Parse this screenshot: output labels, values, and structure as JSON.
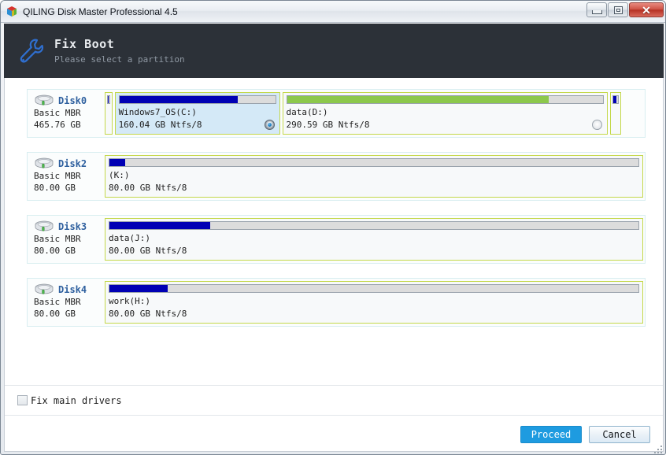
{
  "window": {
    "title": "QILING Disk Master Professional 4.5",
    "logo_icon": "cube-logo-icon",
    "buttons": {
      "minimize": "minimize-icon",
      "maximize": "maximize-icon",
      "close": "close-icon"
    }
  },
  "header": {
    "icon": "wrench-icon",
    "title": "Fix Boot",
    "subtitle": "Please select a partition"
  },
  "disks": [
    {
      "name": "Disk0",
      "type": "Basic MBR",
      "size": "465.76 GB",
      "icon": "hard-disk-icon",
      "partitions": [
        {
          "label": "",
          "size": "",
          "width_pct": 1.4,
          "used_pct": 72,
          "fill_color": "#0000b4",
          "selected": false,
          "radio": "none",
          "tiny": true
        },
        {
          "label": "Windows7_OS(C:)",
          "size": "160.04 GB Ntfs/8",
          "width_pct": 30.7,
          "used_pct": 76,
          "fill_color": "#0000b4",
          "selected": true,
          "radio": "on",
          "tiny": false
        },
        {
          "label": "data(D:)",
          "size": "290.59 GB Ntfs/8",
          "width_pct": 60.4,
          "used_pct": 83,
          "fill_color": "#8cc84b",
          "selected": false,
          "radio": "off",
          "tiny": false
        },
        {
          "label": "",
          "size": "",
          "width_pct": 2.1,
          "used_pct": 72,
          "fill_color": "#0000b4",
          "selected": false,
          "radio": "none",
          "tiny": true
        }
      ]
    },
    {
      "name": "Disk2",
      "type": "Basic MBR",
      "size": "80.00 GB",
      "icon": "hard-disk-icon",
      "partitions": [
        {
          "label": "(K:)",
          "size": "80.00 GB Ntfs/8",
          "width_pct": 100,
          "used_pct": 3,
          "fill_color": "#0000b4",
          "selected": false,
          "radio": "none",
          "tiny": false
        }
      ]
    },
    {
      "name": "Disk3",
      "type": "Basic MBR",
      "size": "80.00 GB",
      "icon": "hard-disk-icon",
      "partitions": [
        {
          "label": "data(J:)",
          "size": "80.00 GB Ntfs/8",
          "width_pct": 100,
          "used_pct": 19,
          "fill_color": "#0000b4",
          "selected": false,
          "radio": "none",
          "tiny": false
        }
      ]
    },
    {
      "name": "Disk4",
      "type": "Basic MBR",
      "size": "80.00 GB",
      "icon": "hard-disk-icon",
      "partitions": [
        {
          "label": "work(H:)",
          "size": "80.00 GB Ntfs/8",
          "width_pct": 100,
          "used_pct": 11,
          "fill_color": "#0000b4",
          "selected": false,
          "radio": "none",
          "tiny": false
        }
      ]
    }
  ],
  "options": {
    "fix_main_drivers": {
      "label": "Fix main drivers",
      "checked": false
    }
  },
  "footer": {
    "proceed_label": "Proceed",
    "cancel_label": "Cancel"
  },
  "colors": {
    "accent": "#1e9be0",
    "header_bg": "#2c3138",
    "partition_border": "#c4d84a",
    "selected_partition_bg": "#d4e9f7",
    "used_blue": "#0000b4",
    "used_green": "#8cc84b",
    "disk_name": "#2d5f9e"
  }
}
